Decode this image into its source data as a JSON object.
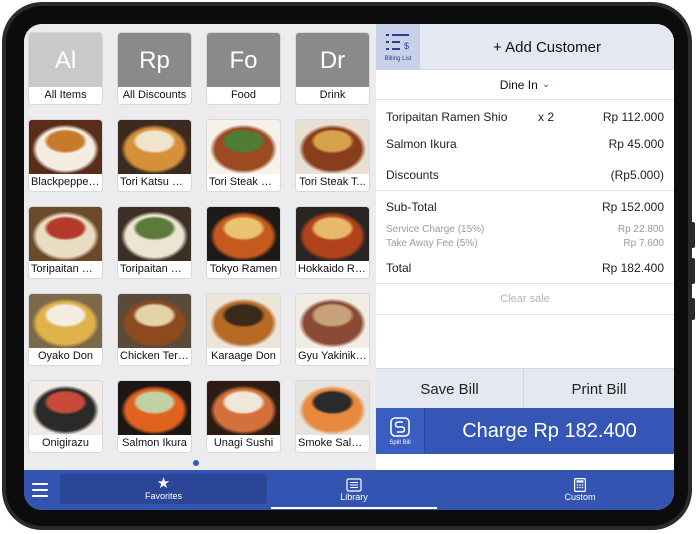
{
  "categories": [
    {
      "abbr": "Al",
      "label": "All Items",
      "tone": "light"
    },
    {
      "abbr": "Rp",
      "label": "All Discounts",
      "tone": "dark"
    },
    {
      "abbr": "Fo",
      "label": "Food",
      "tone": "dark"
    },
    {
      "abbr": "Dr",
      "label": "Drink",
      "tone": "dark"
    }
  ],
  "items": [
    {
      "label": "Blackpepper...",
      "colors": [
        "#5a2c1a",
        "#f3ede2",
        "#c67b2c"
      ]
    },
    {
      "label": "Tori Katsu D...",
      "colors": [
        "#3b2a1f",
        "#d6903a",
        "#f1e4cc"
      ]
    },
    {
      "label": "Tori Steak Hi...",
      "colors": [
        "#f6f1ea",
        "#9b4a22",
        "#4f7d36"
      ]
    },
    {
      "label": "Tori Steak T...",
      "colors": [
        "#e8e1d3",
        "#8a3d1c",
        "#d6a24a"
      ]
    },
    {
      "label": "Toripaitan Ra...",
      "colors": [
        "#6b4a2c",
        "#e9dcc2",
        "#b33a2a"
      ]
    },
    {
      "label": "Toripaitan Ra...",
      "colors": [
        "#3c3026",
        "#ede5d2",
        "#5c7a3a"
      ]
    },
    {
      "label": "Tokyo Ramen",
      "colors": [
        "#1e1a18",
        "#c65a1e",
        "#e8c470"
      ]
    },
    {
      "label": "Hokkaido Ra...",
      "colors": [
        "#2a2422",
        "#b2421c",
        "#e7b96a"
      ]
    },
    {
      "label": "Oyako Don",
      "colors": [
        "#7a6a4a",
        "#e0b24a",
        "#f4ece0"
      ]
    },
    {
      "label": "Chicken Teri...",
      "colors": [
        "#5a4a3a",
        "#8c4a1e",
        "#e6d2a8"
      ]
    },
    {
      "label": "Karaage Don",
      "colors": [
        "#ece6da",
        "#b66a26",
        "#3a2a1c"
      ]
    },
    {
      "label": "Gyu Yakiniku...",
      "colors": [
        "#f1ece4",
        "#8a4a36",
        "#c7a27a"
      ]
    },
    {
      "label": "Onigirazu",
      "colors": [
        "#f1ede6",
        "#2a2a28",
        "#c94a3a"
      ]
    },
    {
      "label": "Salmon Ikura",
      "colors": [
        "#1c1614",
        "#e0621e",
        "#c2d0a4"
      ]
    },
    {
      "label": "Unagi Sushi",
      "colors": [
        "#2c1c14",
        "#d4703a",
        "#efe7d8"
      ]
    },
    {
      "label": "Smoke Salm...",
      "colors": [
        "#e6e3de",
        "#e88a3e",
        "#2a2a2a"
      ]
    }
  ],
  "header": {
    "billing_list_label": "Billing List",
    "add_customer": "+ Add Customer"
  },
  "order_type": "Dine In",
  "order_lines": [
    {
      "name": "Toripaitan Ramen Shio",
      "qty": "x 2",
      "price": "Rp 112.000"
    },
    {
      "name": "Salmon Ikura",
      "qty": "",
      "price": "Rp 45.000"
    }
  ],
  "discounts": {
    "label": "Discounts",
    "value": "(Rp5.000)"
  },
  "subtotal": {
    "label": "Sub-Total",
    "value": "Rp 152.000"
  },
  "fees": [
    {
      "label": "Service Charge (15%)",
      "value": "Rp 22.800"
    },
    {
      "label": "Take Away Fee (5%)",
      "value": "Rp 7.600"
    }
  ],
  "total": {
    "label": "Total",
    "value": "Rp 182.400"
  },
  "clear_sale": "Clear sale",
  "save_bill": "Save Bill",
  "print_bill": "Print Bill",
  "split_bill": "Split Bill",
  "charge": "Charge Rp 182.400",
  "nav": {
    "favorites": "Favorites",
    "library": "Library",
    "custom": "Custom"
  }
}
